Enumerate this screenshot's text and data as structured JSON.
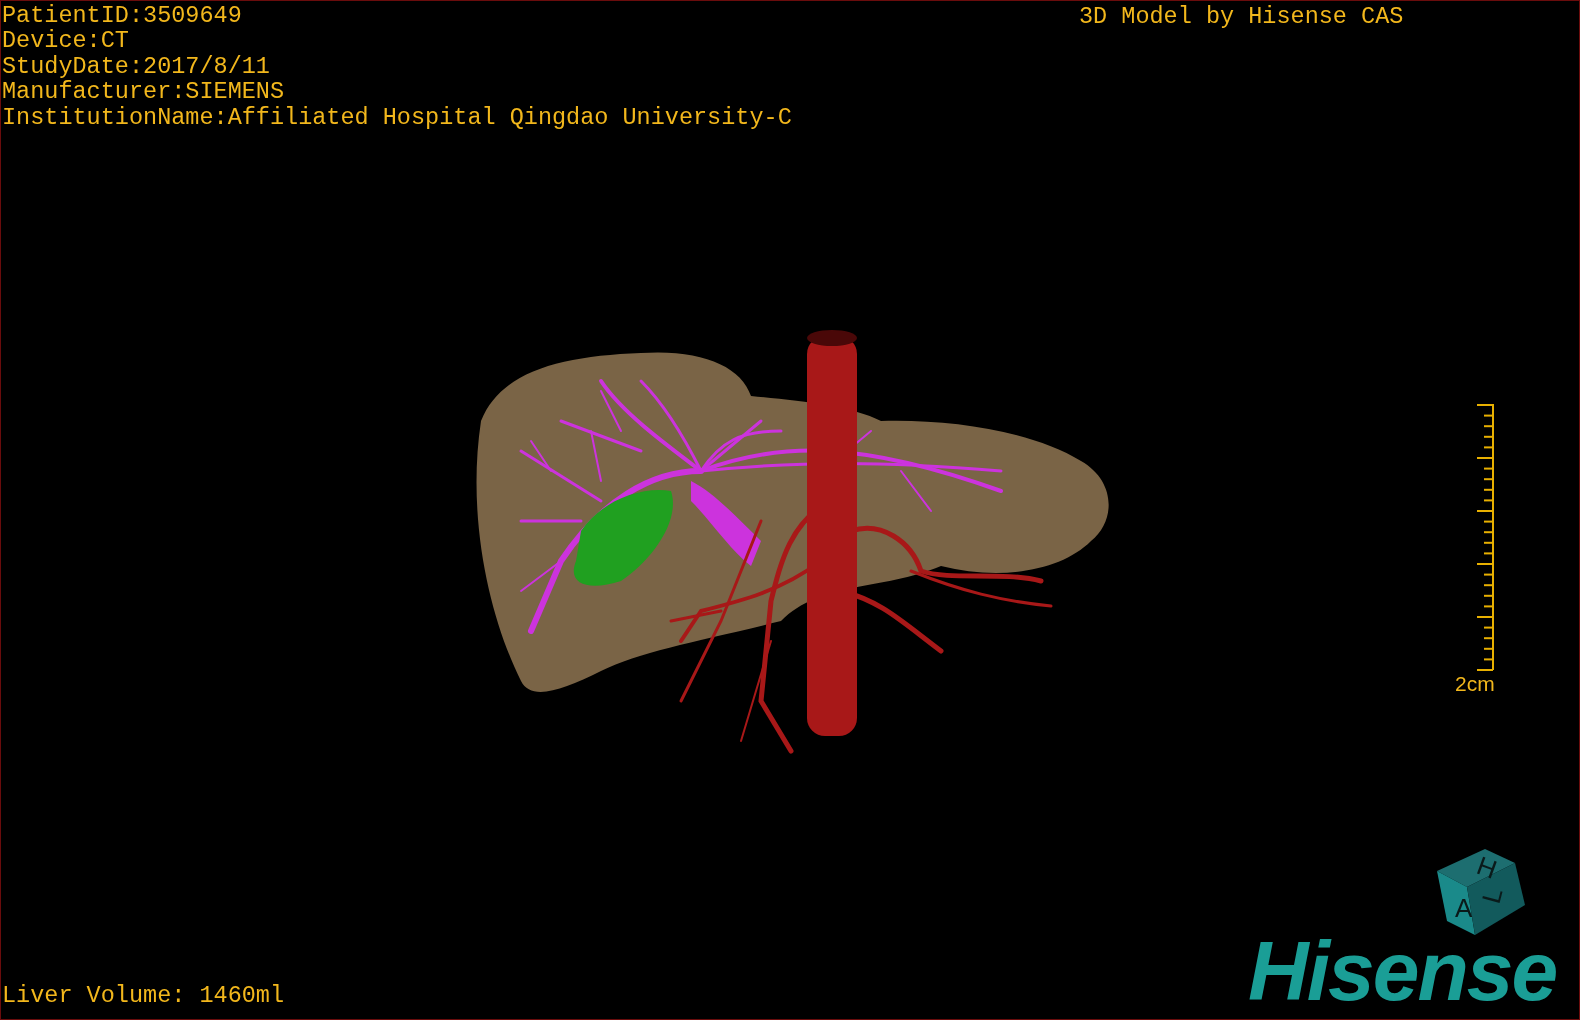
{
  "patient_info": [
    "PatientID:3509649",
    "Device:CT",
    "StudyDate:2017/8/11",
    "Manufacturer:SIEMENS",
    "InstitutionName:Affiliated Hospital Qingdao University-C"
  ],
  "title": "3D Model by Hisense CAS",
  "scale_bar": {
    "label": "2cm"
  },
  "orientation_cube": {
    "top": "H",
    "front": "A",
    "side": "L"
  },
  "liver_volume": "Liver Volume: 1460ml",
  "logo": "Hisense"
}
